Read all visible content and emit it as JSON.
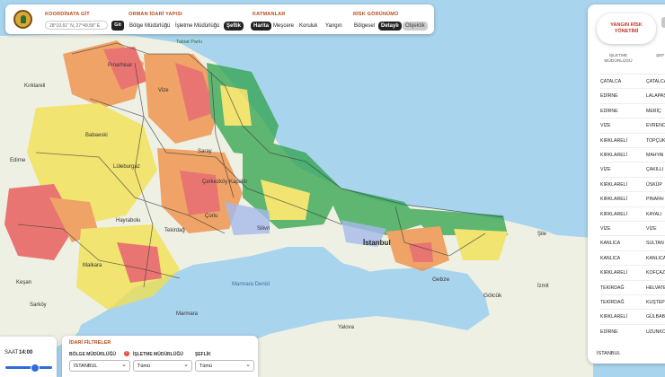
{
  "colors": {
    "water": "#a9d4ee",
    "land": "#eef0e4",
    "risk_low": "#2fa34a",
    "risk_mid": "#f2e14b",
    "risk_high": "#f08a3c",
    "risk_extreme": "#e84c4c",
    "accent": "#b84a1a"
  },
  "map_labels": [
    {
      "name": "Tekirdağ"
    },
    {
      "name": "Kırklareli"
    },
    {
      "name": "Tabiat Parkı"
    },
    {
      "name": "Çorlu"
    },
    {
      "name": "Silivri"
    },
    {
      "name": "İstanbul"
    },
    {
      "name": "Gebze"
    },
    {
      "name": "Gölcük"
    },
    {
      "name": "Yalova"
    },
    {
      "name": "Marmara"
    },
    {
      "name": "Edirne"
    },
    {
      "name": "Lüleburgaz"
    },
    {
      "name": "Babaeski"
    },
    {
      "name": "Kapaklı"
    },
    {
      "name": "Sarköy"
    },
    {
      "name": "İzmit"
    },
    {
      "name": "Şile"
    },
    {
      "name": "Pınarhisar"
    },
    {
      "name": "Saray"
    },
    {
      "name": "Vize"
    },
    {
      "name": "Malkara"
    },
    {
      "name": "Keşan"
    },
    {
      "name": "Hayrabolu"
    },
    {
      "name": "Çerkezköy"
    },
    {
      "name": "Marmara Denizi"
    }
  ],
  "top_bar": {
    "coord_title": "KOORDİNATA GİT",
    "coord_placeholder": "28°10.61\" N, 27°49.58\" E",
    "go_label": "Git",
    "admin_title": "ORMAN İDARİ YAPISI",
    "admin_options": [
      "Bölge Müdürlüğü",
      "İşletme Müdürlüğü",
      "Şeflik"
    ],
    "layers_title": "KATMANLAR",
    "layer_options": [
      "Harita",
      "Meşcere",
      "Koruluk",
      "Yangın"
    ],
    "risk_title": "RİSK GÖRÜNÜMÜ",
    "risk_options": [
      "Bölgesel",
      "Detaylı",
      "Objektik"
    ]
  },
  "side_panel": {
    "title_line1": "YANGIN RİSK",
    "title_line2": "YÖNETİMİ",
    "col1_line1": "İŞLETME",
    "col1_line2": "MÜDÜRLÜĞÜ",
    "col2": "ŞEF",
    "rows": [
      {
        "a": "ÇATALCA",
        "b": "ÇATALCA"
      },
      {
        "a": "EDİRNE",
        "b": "LALAPAŞ"
      },
      {
        "a": "EDİRNE",
        "b": "MERİÇ"
      },
      {
        "a": "VİZE",
        "b": "EVRENC"
      },
      {
        "a": "KIRKLARELİ",
        "b": "TOPÇUK"
      },
      {
        "a": "KIRKLARELİ",
        "b": "MAHYAI"
      },
      {
        "a": "VİZE",
        "b": "ÇAKILLI"
      },
      {
        "a": "KIRKLARELİ",
        "b": "ÜSKÜP"
      },
      {
        "a": "KIRKLARELİ",
        "b": "PINARH"
      },
      {
        "a": "KIRKLARELİ",
        "b": "KAYALI"
      },
      {
        "a": "VİZE",
        "b": "VİZE"
      },
      {
        "a": "KANLICA",
        "b": "SULTAN"
      },
      {
        "a": "KANLICA",
        "b": "KANLICA"
      },
      {
        "a": "KIRKLARELİ",
        "b": "KOFÇAZ"
      },
      {
        "a": "TEKİRDAĞ",
        "b": "HELVATE"
      },
      {
        "a": "TEKİRDAĞ",
        "b": "KUŞTEP"
      },
      {
        "a": "KIRKLARELİ",
        "b": "GÜLBAB"
      },
      {
        "a": "EDİRNE",
        "b": "UZUNKC"
      }
    ],
    "footer": "İSTANBUL"
  },
  "time_panel": {
    "label": "SAAT",
    "value": "14:00",
    "progress": 0.62
  },
  "filter_panel": {
    "title": "İDARİ FİLTRELER",
    "bolge_label": "BÖLGE MÜDÜRLÜĞÜ",
    "bolge_value": "İSTANBUL",
    "isletme_label": "İŞLETME MÜDÜRLÜĞÜ",
    "isletme_value": "Tümü",
    "seflik_label": "ŞEFLİK",
    "seflik_value": "Tümü"
  }
}
